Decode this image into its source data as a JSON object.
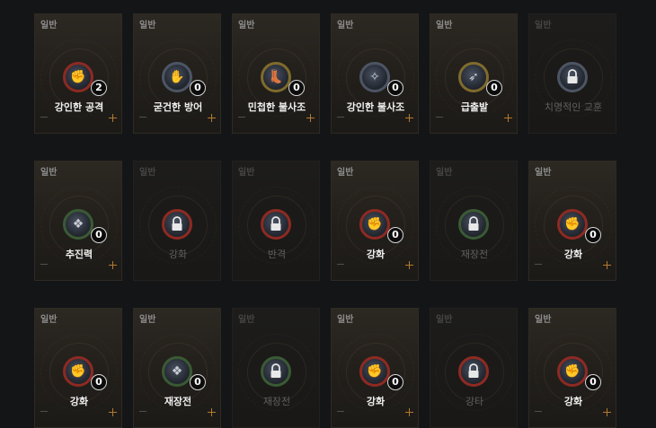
{
  "cards": [
    {
      "category": "일반",
      "name": "강인한 공격",
      "count": "2",
      "locked": false,
      "icon": "fist-swirl-icon",
      "ring": "#8e2a22"
    },
    {
      "category": "일반",
      "name": "굳건한 방어",
      "count": "0",
      "locked": false,
      "icon": "shield-arm-icon",
      "ring": "#4c5563"
    },
    {
      "category": "일반",
      "name": "민첩한 불사조",
      "count": "0",
      "locked": false,
      "icon": "boot-icon",
      "ring": "#7f6b2c"
    },
    {
      "category": "일반",
      "name": "강인한 불사조",
      "count": "0",
      "locked": false,
      "icon": "phoenix-icon",
      "ring": "#4c5563"
    },
    {
      "category": "일반",
      "name": "급출발",
      "count": "0",
      "locked": false,
      "icon": "sprint-icon",
      "ring": "#7f6b2c"
    },
    {
      "category": "일반",
      "name": "치명적인 교훈",
      "count": "",
      "locked": true,
      "icon": "lock-icon",
      "ring": "#4c5563"
    },
    {
      "category": "일반",
      "name": "추진력",
      "count": "0",
      "locked": false,
      "icon": "gem-cluster-icon",
      "ring": "#3a5a34"
    },
    {
      "category": "일반",
      "name": "강화",
      "count": "",
      "locked": true,
      "icon": "lock-icon",
      "ring": "#8e2a22"
    },
    {
      "category": "일반",
      "name": "반격",
      "count": "",
      "locked": true,
      "icon": "lock-icon",
      "ring": "#8e2a22"
    },
    {
      "category": "일반",
      "name": "강화",
      "count": "0",
      "locked": false,
      "icon": "fist-icon",
      "ring": "#8e2a22"
    },
    {
      "category": "일반",
      "name": "재장전",
      "count": "",
      "locked": true,
      "icon": "gem-cluster-icon",
      "ring": "#3a5a34"
    },
    {
      "category": "일반",
      "name": "강화",
      "count": "0",
      "locked": false,
      "icon": "fist-icon",
      "ring": "#8e2a22"
    },
    {
      "category": "일반",
      "name": "강화",
      "count": "0",
      "locked": false,
      "icon": "fist-icon",
      "ring": "#8e2a22"
    },
    {
      "category": "일반",
      "name": "재장전",
      "count": "0",
      "locked": false,
      "icon": "gem-cluster-icon",
      "ring": "#3a5a34"
    },
    {
      "category": "일반",
      "name": "재장전",
      "count": "",
      "locked": true,
      "icon": "lock-icon",
      "ring": "#3a5a34"
    },
    {
      "category": "일반",
      "name": "강화",
      "count": "0",
      "locked": false,
      "icon": "fist-icon",
      "ring": "#8e2a22"
    },
    {
      "category": "일반",
      "name": "강타",
      "count": "",
      "locked": true,
      "icon": "lock-icon",
      "ring": "#8e2a22"
    },
    {
      "category": "일반",
      "name": "강화",
      "count": "0",
      "locked": false,
      "icon": "fist-icon",
      "ring": "#8e2a22"
    }
  ]
}
